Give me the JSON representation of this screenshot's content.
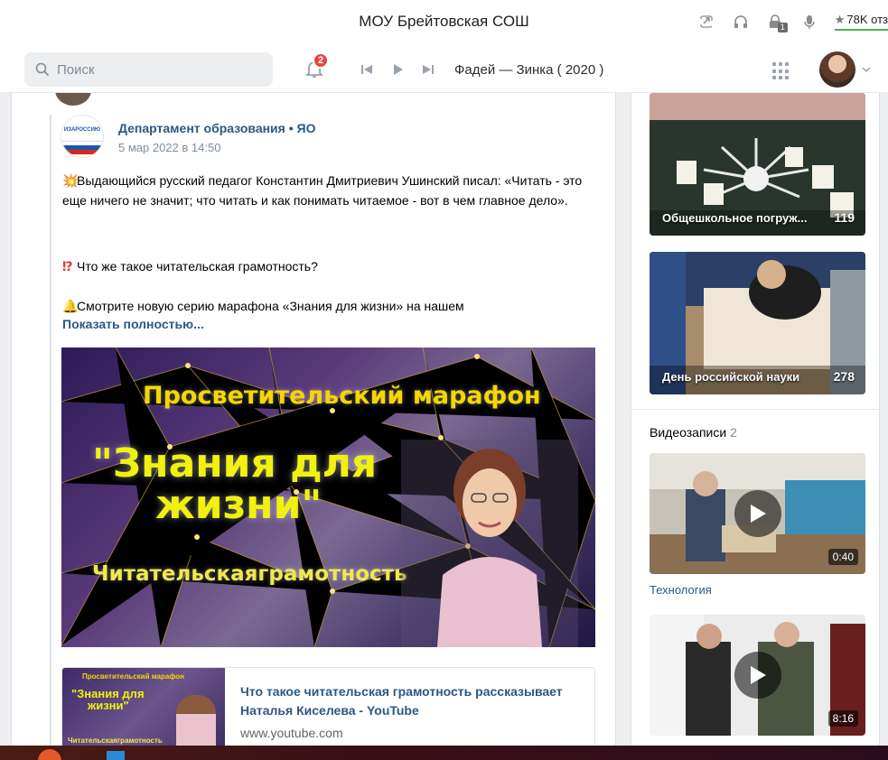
{
  "titlebar": {
    "title": "МОУ Брейтовская СОШ",
    "rating": "78K отз",
    "tab_badge": "1",
    "icons": [
      "share-icon",
      "headphones-icon",
      "lock-icon",
      "microphone-icon",
      "star-icon"
    ]
  },
  "header": {
    "search_placeholder": "Поиск",
    "notifications_count": "2",
    "track": "Фадей — Зинка ( 2020 )"
  },
  "post": {
    "source_name": "Департамент образования • ЯО",
    "source_logo_text": "ИЗАРОССИЮ",
    "date": "5 мар 2022 в 14:50",
    "emoji1": "💥",
    "line1": "Выдающийся русский педагог Константин Дмитриевич Ушинский писал: «Читать - это еще ничего не значит; что читать и как понимать читаемое - вот в чем главное дело».",
    "emoji2": "⁉",
    "line2": "Что же такое читательская грамотность?",
    "emoji3": "🔔",
    "line3": "Смотрите новую серию марафона «Знания для жизни» на нашем",
    "show_more": "Показать полностью...",
    "video": {
      "title_top": "Просветительский марафон",
      "title_main_1": "\"Знания для",
      "title_main_2": "жизни\"",
      "title_bottom": "Читательскаяграмотность"
    },
    "link": {
      "thumb_top": "Просветительский марафон",
      "thumb_main_1": "\"Знания для",
      "thumb_main_2": "жизни\"",
      "thumb_bottom": "Читательскаяграмотность",
      "title": "Что такое читательская грамотность рассказывает Наталья Киселева - YouTube",
      "url": "www.youtube.com"
    }
  },
  "sidebar": {
    "albums": [
      {
        "name": "Общешкольное погруж...",
        "count": "119"
      },
      {
        "name": "День российской науки",
        "count": "278"
      }
    ],
    "videos_label": "Видеозаписи",
    "videos_count": "2",
    "videos": [
      {
        "title": "Технология",
        "duration": "0:40"
      },
      {
        "title": "",
        "duration": "8:16"
      }
    ]
  },
  "colors": {
    "link": "#2a5885",
    "badge": "#e64646",
    "meta": "#818c99",
    "rating_underline": "#4bb34b"
  }
}
